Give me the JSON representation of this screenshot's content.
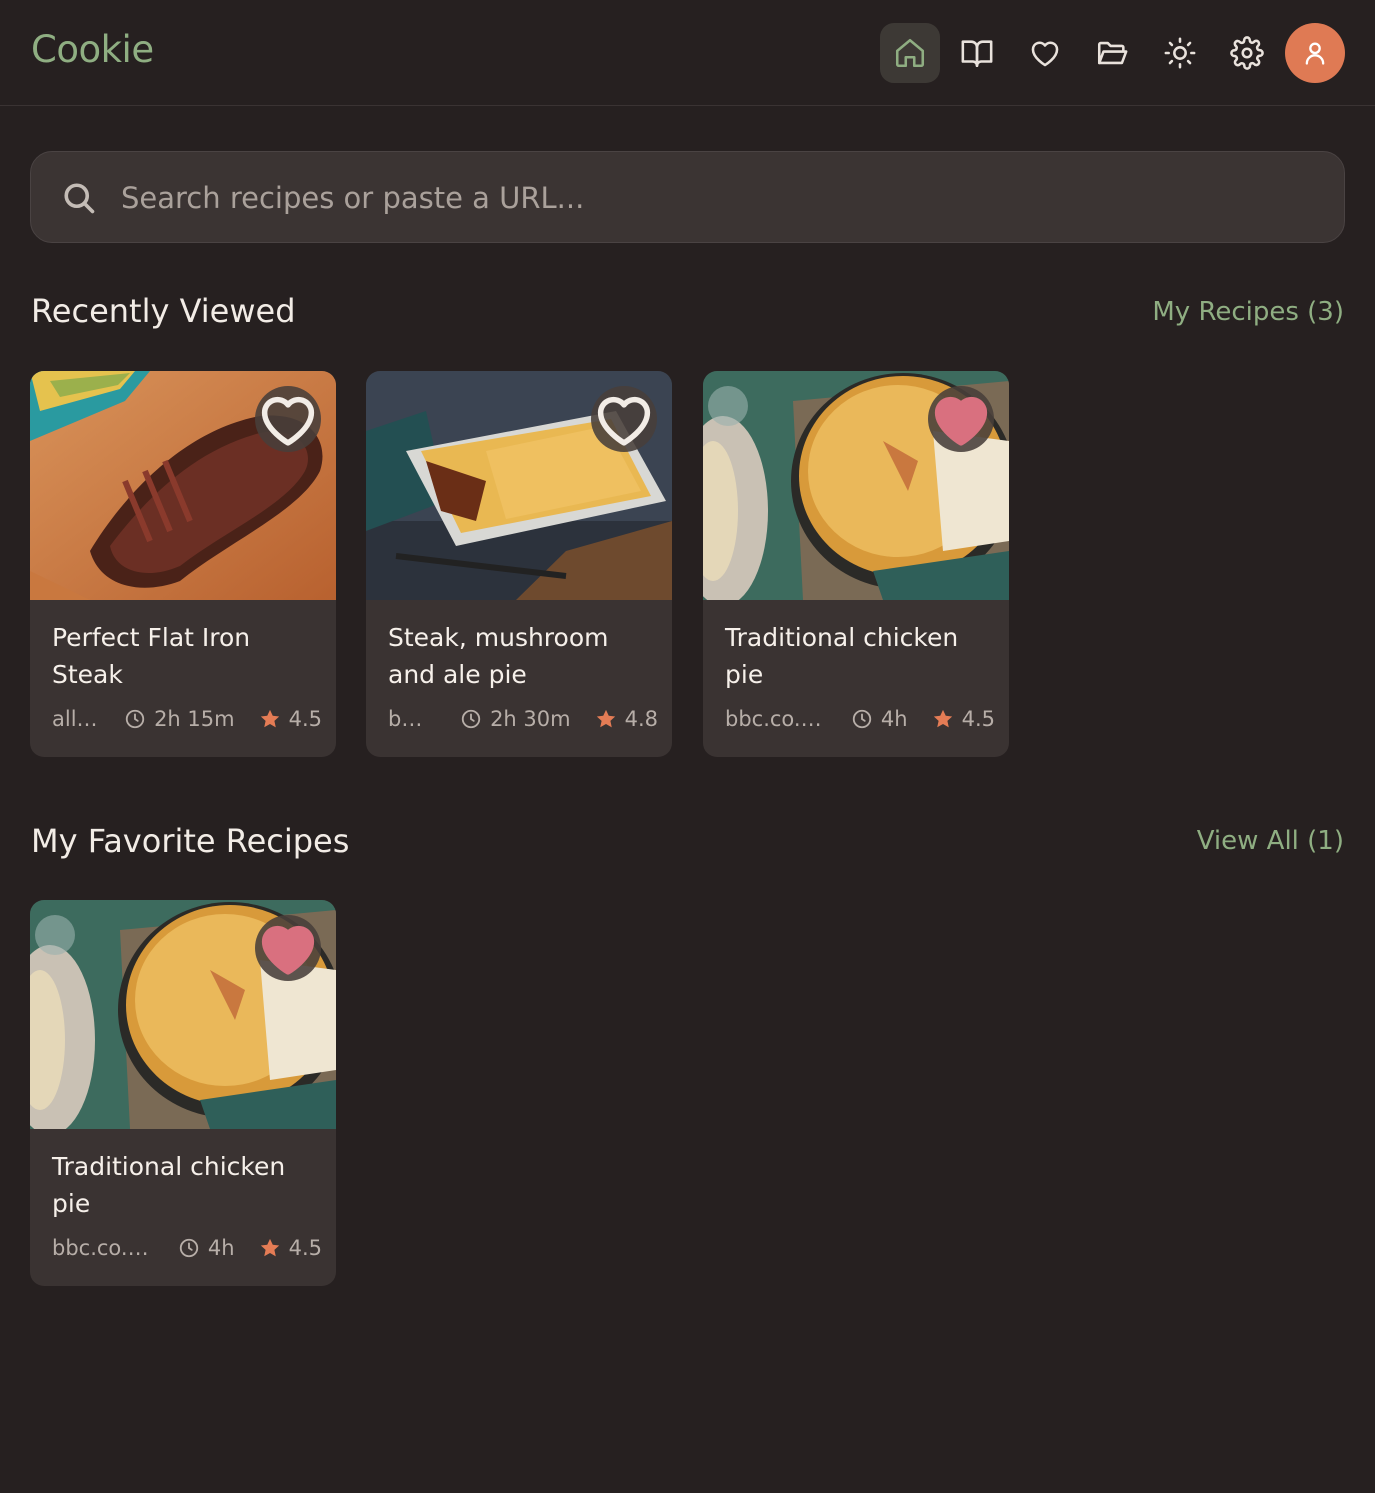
{
  "app": {
    "name": "Cookie"
  },
  "nav": {
    "items": [
      {
        "name": "home",
        "icon": "home-icon",
        "active": true
      },
      {
        "name": "recipes",
        "icon": "book-icon",
        "active": false
      },
      {
        "name": "favorites",
        "icon": "heart-icon",
        "active": false
      },
      {
        "name": "collections",
        "icon": "folder-icon",
        "active": false
      },
      {
        "name": "theme",
        "icon": "sun-icon",
        "active": false
      },
      {
        "name": "settings",
        "icon": "gear-icon",
        "active": false
      }
    ],
    "avatar_icon": "user-icon"
  },
  "search": {
    "placeholder": "Search recipes or paste a URL..."
  },
  "recently_viewed": {
    "title": "Recently Viewed",
    "link": "My Recipes (3)",
    "items": [
      {
        "title": "Perfect Flat Iron Steak",
        "source": "allrecipes.com",
        "time": "2h 15m",
        "rating": "4.5",
        "favorite": false,
        "image": "steak"
      },
      {
        "title": "Steak, mushroom and ale pie",
        "source": "bbc.co.uk",
        "time": "2h 30m",
        "rating": "4.8",
        "favorite": false,
        "image": "ale-pie"
      },
      {
        "title": "Traditional chicken pie",
        "source": "bbc.co.uk",
        "time": "4h",
        "rating": "4.5",
        "favorite": true,
        "image": "chicken-pie"
      }
    ]
  },
  "favorites": {
    "title": "My Favorite Recipes",
    "link": "View All (1)",
    "items": [
      {
        "title": "Traditional chicken pie",
        "source": "bbc.co.uk",
        "time": "4h",
        "rating": "4.5",
        "favorite": true,
        "image": "chicken-pie"
      }
    ]
  },
  "colors": {
    "background": "#262020",
    "card": "#3a3332",
    "accent_green": "#8fae82",
    "accent_orange": "#df7a54",
    "heart_pink": "#d9707f",
    "star": "#e47c55"
  }
}
